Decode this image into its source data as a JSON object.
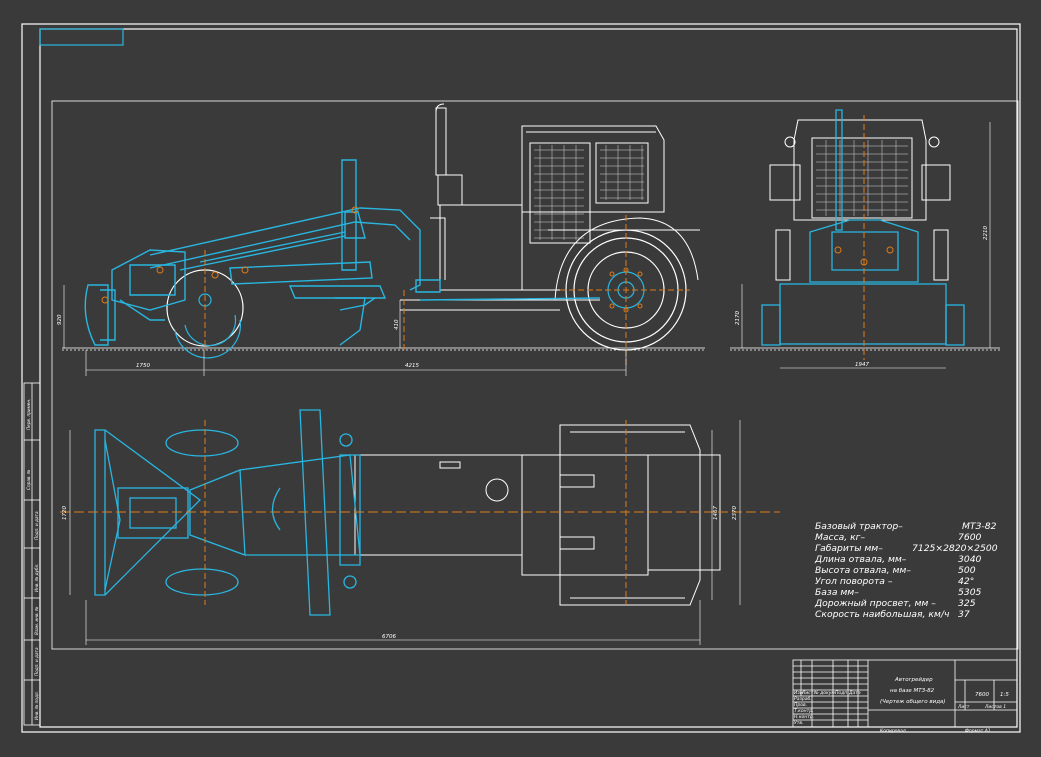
{
  "drawing": {
    "background_color": "#3a3a3a",
    "line_color_white": "#ffffff",
    "line_color_cyan": "#29b6e0",
    "axis_color_orange": "#e07a18"
  },
  "dimensions": {
    "side_height_blade": "920",
    "side_left_length": "1750",
    "side_main_length": "4215",
    "side_blade_height": "410",
    "front_total_height": "2210",
    "front_height": "2170",
    "front_width": "1947",
    "plan_width_left": "1720",
    "plan_track": "1467",
    "plan_overall_width": "2370",
    "plan_total_length": "6706"
  },
  "specs": [
    {
      "label": "Базовый трактор–",
      "value": "МТЗ-82"
    },
    {
      "label": "Масса, кг–",
      "value": "7600"
    },
    {
      "label": "Габариты мм–",
      "value": "7125×2820×2500"
    },
    {
      "label": "Длина отвала, мм–",
      "value": "3040"
    },
    {
      "label": "Высота отвала, мм–",
      "value": "500"
    },
    {
      "label": "Угол поворота –",
      "value": "42°"
    },
    {
      "label": "База мм–",
      "value": "5305"
    },
    {
      "label": "Дорожный просвет, мм –",
      "value": "325"
    },
    {
      "label": "Скорость наибольшая, км/ч",
      "value": "37"
    }
  ],
  "title_block": {
    "line1": "Автогрейдер",
    "line2": "на базе МТЗ-82",
    "line3": "(Чертеж общего вида)",
    "mass": "7600",
    "scale": "1:5",
    "row_labels": [
      "Изм",
      "Лист",
      "№ докум.",
      "Подп.",
      "Дата",
      "Разраб.",
      "Пров.",
      "Т.контр.",
      "Н.контр.",
      "Утв."
    ],
    "sheet_label": "Лист",
    "sheets_label": "Листов 1",
    "copy_label": "Копировал",
    "format_label": "Формат А1"
  },
  "side_strip": [
    "Перв. примен.",
    "Справ. №",
    "Подп. и дата",
    "Инв. № дубл.",
    "Взам. инв. №",
    "Подп. и дата",
    "Инв. № подл."
  ]
}
